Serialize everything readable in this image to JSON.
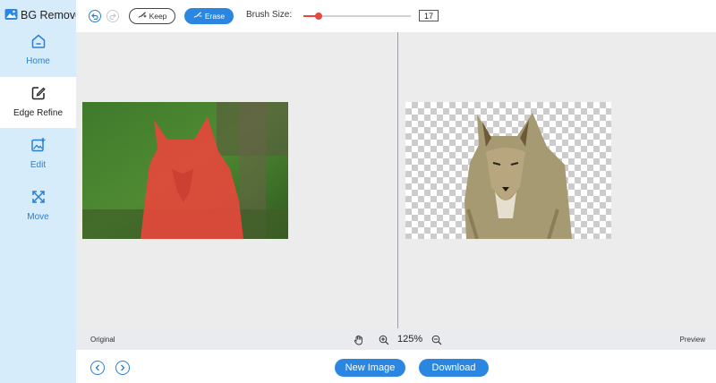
{
  "app": {
    "title": "BG Remover"
  },
  "sidebar": {
    "items": [
      {
        "label": "Home",
        "icon": "home-icon"
      },
      {
        "label": "Edge Refine",
        "icon": "edit-square-icon",
        "active": true
      },
      {
        "label": "Edit",
        "icon": "image-edit-icon"
      },
      {
        "label": "Move",
        "icon": "move-arrows-icon"
      }
    ]
  },
  "toolbar": {
    "keep_label": "Keep",
    "erase_label": "Erase",
    "brush_label": "Brush Size:",
    "brush_value": "17",
    "brush_level_fraction": 0.14
  },
  "canvas": {
    "original_label": "Original",
    "preview_label": "Preview",
    "zoom_level": "125%"
  },
  "footer": {
    "new_image_label": "New Image",
    "download_label": "Download"
  },
  "colors": {
    "accent": "#2a86e0",
    "sidebar_bg": "#d6ecfb",
    "brush_color": "#e8473c",
    "mask_overlay": "#e8473c"
  }
}
